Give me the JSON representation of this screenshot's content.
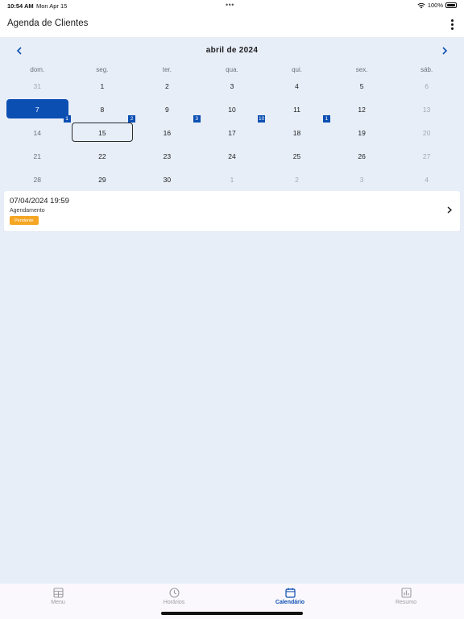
{
  "status_bar": {
    "time": "10:54 AM",
    "date": "Mon Apr 15",
    "battery": "100%"
  },
  "header": {
    "title": "Agenda de Clientes"
  },
  "calendar": {
    "month_title": "abril de 2024",
    "weekdays": [
      "dom.",
      "seg.",
      "ter.",
      "qua.",
      "qui.",
      "sex.",
      "sáb."
    ],
    "weeks": [
      [
        {
          "n": "31",
          "out": true
        },
        {
          "n": "1"
        },
        {
          "n": "2"
        },
        {
          "n": "3"
        },
        {
          "n": "4"
        },
        {
          "n": "5"
        },
        {
          "n": "6",
          "out": true
        }
      ],
      [
        {
          "n": "7",
          "selected": true,
          "badge": "1"
        },
        {
          "n": "8",
          "badge": "2"
        },
        {
          "n": "9",
          "badge": "3"
        },
        {
          "n": "10",
          "badge": "10"
        },
        {
          "n": "11",
          "badge": "1"
        },
        {
          "n": "12"
        },
        {
          "n": "13",
          "out": true
        }
      ],
      [
        {
          "n": "14",
          "sun": true
        },
        {
          "n": "15",
          "today": true
        },
        {
          "n": "16"
        },
        {
          "n": "17"
        },
        {
          "n": "18"
        },
        {
          "n": "19"
        },
        {
          "n": "20",
          "out": true
        }
      ],
      [
        {
          "n": "21",
          "sun": true
        },
        {
          "n": "22"
        },
        {
          "n": "23"
        },
        {
          "n": "24"
        },
        {
          "n": "25"
        },
        {
          "n": "26"
        },
        {
          "n": "27",
          "out": true
        }
      ],
      [
        {
          "n": "28",
          "sun": true
        },
        {
          "n": "29"
        },
        {
          "n": "30"
        },
        {
          "n": "1",
          "out": true
        },
        {
          "n": "2",
          "out": true
        },
        {
          "n": "3",
          "out": true
        },
        {
          "n": "4",
          "out": true
        }
      ]
    ]
  },
  "event": {
    "datetime": "07/04/2024 19:59",
    "type": "Agendamento",
    "status": "Pendente",
    "status_color": "#f5a623"
  },
  "tabbar": {
    "tabs": [
      {
        "label": "Menu",
        "icon": "table-icon",
        "active": false
      },
      {
        "label": "Horários",
        "icon": "clock-icon",
        "active": false
      },
      {
        "label": "Calendário",
        "icon": "calendar-icon",
        "active": true
      },
      {
        "label": "Resumo",
        "icon": "chart-icon",
        "active": false
      }
    ]
  },
  "colors": {
    "accent": "#0c4fb3",
    "background": "#e8eef8"
  }
}
